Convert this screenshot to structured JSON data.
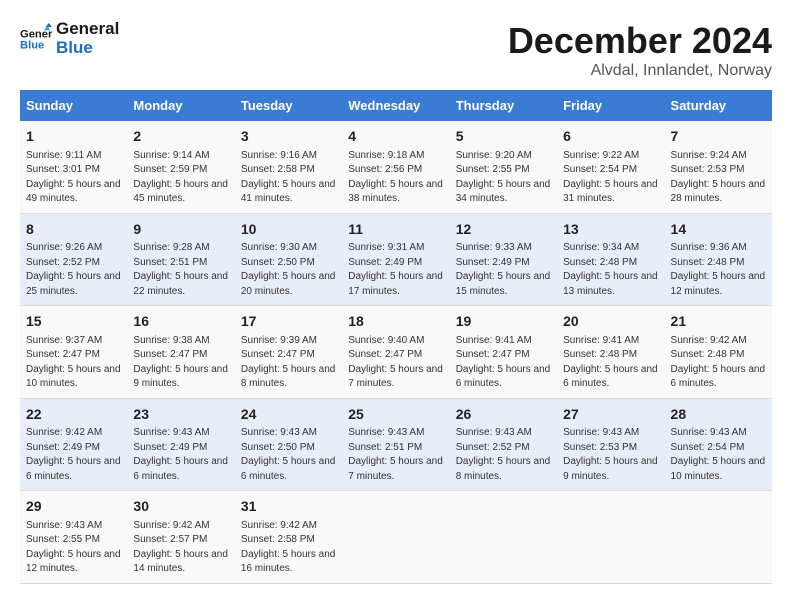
{
  "header": {
    "logo_line1": "General",
    "logo_line2": "Blue",
    "month": "December 2024",
    "location": "Alvdal, Innlandet, Norway"
  },
  "columns": [
    "Sunday",
    "Monday",
    "Tuesday",
    "Wednesday",
    "Thursday",
    "Friday",
    "Saturday"
  ],
  "weeks": [
    [
      {
        "day": "1",
        "sunrise": "9:11 AM",
        "sunset": "3:01 PM",
        "daylight": "5 hours and 49 minutes."
      },
      {
        "day": "2",
        "sunrise": "9:14 AM",
        "sunset": "2:59 PM",
        "daylight": "5 hours and 45 minutes."
      },
      {
        "day": "3",
        "sunrise": "9:16 AM",
        "sunset": "2:58 PM",
        "daylight": "5 hours and 41 minutes."
      },
      {
        "day": "4",
        "sunrise": "9:18 AM",
        "sunset": "2:56 PM",
        "daylight": "5 hours and 38 minutes."
      },
      {
        "day": "5",
        "sunrise": "9:20 AM",
        "sunset": "2:55 PM",
        "daylight": "5 hours and 34 minutes."
      },
      {
        "day": "6",
        "sunrise": "9:22 AM",
        "sunset": "2:54 PM",
        "daylight": "5 hours and 31 minutes."
      },
      {
        "day": "7",
        "sunrise": "9:24 AM",
        "sunset": "2:53 PM",
        "daylight": "5 hours and 28 minutes."
      }
    ],
    [
      {
        "day": "8",
        "sunrise": "9:26 AM",
        "sunset": "2:52 PM",
        "daylight": "5 hours and 25 minutes."
      },
      {
        "day": "9",
        "sunrise": "9:28 AM",
        "sunset": "2:51 PM",
        "daylight": "5 hours and 22 minutes."
      },
      {
        "day": "10",
        "sunrise": "9:30 AM",
        "sunset": "2:50 PM",
        "daylight": "5 hours and 20 minutes."
      },
      {
        "day": "11",
        "sunrise": "9:31 AM",
        "sunset": "2:49 PM",
        "daylight": "5 hours and 17 minutes."
      },
      {
        "day": "12",
        "sunrise": "9:33 AM",
        "sunset": "2:49 PM",
        "daylight": "5 hours and 15 minutes."
      },
      {
        "day": "13",
        "sunrise": "9:34 AM",
        "sunset": "2:48 PM",
        "daylight": "5 hours and 13 minutes."
      },
      {
        "day": "14",
        "sunrise": "9:36 AM",
        "sunset": "2:48 PM",
        "daylight": "5 hours and 12 minutes."
      }
    ],
    [
      {
        "day": "15",
        "sunrise": "9:37 AM",
        "sunset": "2:47 PM",
        "daylight": "5 hours and 10 minutes."
      },
      {
        "day": "16",
        "sunrise": "9:38 AM",
        "sunset": "2:47 PM",
        "daylight": "5 hours and 9 minutes."
      },
      {
        "day": "17",
        "sunrise": "9:39 AM",
        "sunset": "2:47 PM",
        "daylight": "5 hours and 8 minutes."
      },
      {
        "day": "18",
        "sunrise": "9:40 AM",
        "sunset": "2:47 PM",
        "daylight": "5 hours and 7 minutes."
      },
      {
        "day": "19",
        "sunrise": "9:41 AM",
        "sunset": "2:47 PM",
        "daylight": "5 hours and 6 minutes."
      },
      {
        "day": "20",
        "sunrise": "9:41 AM",
        "sunset": "2:48 PM",
        "daylight": "5 hours and 6 minutes."
      },
      {
        "day": "21",
        "sunrise": "9:42 AM",
        "sunset": "2:48 PM",
        "daylight": "5 hours and 6 minutes."
      }
    ],
    [
      {
        "day": "22",
        "sunrise": "9:42 AM",
        "sunset": "2:49 PM",
        "daylight": "5 hours and 6 minutes."
      },
      {
        "day": "23",
        "sunrise": "9:43 AM",
        "sunset": "2:49 PM",
        "daylight": "5 hours and 6 minutes."
      },
      {
        "day": "24",
        "sunrise": "9:43 AM",
        "sunset": "2:50 PM",
        "daylight": "5 hours and 6 minutes."
      },
      {
        "day": "25",
        "sunrise": "9:43 AM",
        "sunset": "2:51 PM",
        "daylight": "5 hours and 7 minutes."
      },
      {
        "day": "26",
        "sunrise": "9:43 AM",
        "sunset": "2:52 PM",
        "daylight": "5 hours and 8 minutes."
      },
      {
        "day": "27",
        "sunrise": "9:43 AM",
        "sunset": "2:53 PM",
        "daylight": "5 hours and 9 minutes."
      },
      {
        "day": "28",
        "sunrise": "9:43 AM",
        "sunset": "2:54 PM",
        "daylight": "5 hours and 10 minutes."
      }
    ],
    [
      {
        "day": "29",
        "sunrise": "9:43 AM",
        "sunset": "2:55 PM",
        "daylight": "5 hours and 12 minutes."
      },
      {
        "day": "30",
        "sunrise": "9:42 AM",
        "sunset": "2:57 PM",
        "daylight": "5 hours and 14 minutes."
      },
      {
        "day": "31",
        "sunrise": "9:42 AM",
        "sunset": "2:58 PM",
        "daylight": "5 hours and 16 minutes."
      },
      null,
      null,
      null,
      null
    ]
  ]
}
